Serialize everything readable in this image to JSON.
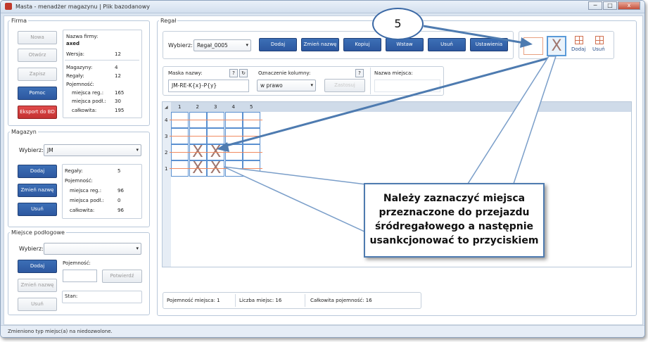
{
  "window": {
    "title": "Masta - menadżer magazynu | Plik bazodanowy",
    "min": "─",
    "max": "□",
    "close": "x"
  },
  "firma": {
    "legend": "Firma",
    "buttons": {
      "nowa": "Nowa",
      "otworz": "Otwórz",
      "zapisz": "Zapisz",
      "pomoc": "Pomoc",
      "eksport": "Eksport do BD"
    },
    "info": {
      "nazwa_label": "Nazwa firmy:",
      "nazwa_value": "axed",
      "wersja_label": "Wersja:",
      "wersja_value": "12",
      "magazyny_label": "Magazyny:",
      "magazyny_value": "4",
      "regaly_label": "Regały:",
      "regaly_value": "12",
      "pojemnosc_label": "Pojemność:",
      "mreg_label": "miejsca reg.:",
      "mreg_value": "165",
      "mpodl_label": "miejsca podł.:",
      "mpodl_value": "30",
      "calk_label": "całkowita:",
      "calk_value": "195"
    }
  },
  "magazyn": {
    "legend": "Magazyn",
    "wybierz_label": "Wybierz:",
    "selected": "JM",
    "buttons": {
      "dodaj": "Dodaj",
      "zmien": "Zmień nazwę",
      "usun": "Usuń"
    },
    "info": {
      "regaly_label": "Regały:",
      "regaly_value": "5",
      "pojemnosc_label": "Pojemność:",
      "mreg_label": "miejsca reg.:",
      "mreg_value": "96",
      "mpodl_label": "miejsca podł.:",
      "mpodl_value": "0",
      "calk_label": "całkowita:",
      "calk_value": "96"
    }
  },
  "miejsce": {
    "legend": "Miejsce podłogowe",
    "wybierz_label": "Wybierz:",
    "selected": "",
    "pojemnosc_label": "Pojemność:",
    "stan_label": "Stan:",
    "buttons": {
      "dodaj": "Dodaj",
      "zmien": "Zmień nazwę",
      "usun": "Usuń",
      "potwierdz": "Potwierdź"
    }
  },
  "regal": {
    "legend": "Regał",
    "wybierz_label": "Wybierz:",
    "selected": "Regał_0005",
    "buttons": {
      "dodaj": "Dodaj",
      "zmien": "Zmień nazwę",
      "kopiuj": "Kopiuj",
      "wstaw": "Wstaw",
      "usun": "Usuń",
      "ustawienia": "Ustawienia"
    },
    "tools": {
      "dodaj": "Dodaj",
      "usun": "Usuń"
    },
    "maska_label": "Maska nazwy:",
    "maska_help": "?",
    "maska_value": "JM-RE-K{x}-P{y}",
    "oznaczenie_label": "Oznaczenie kolumny:",
    "oznaczenie_help": "?",
    "oznaczenie_value": "w prawo",
    "zastosuj": "Zastosuj",
    "nazwa_miejsca_label": "Nazwa miejsca:",
    "nazwa_miejsca_value": ""
  },
  "grid": {
    "columns": [
      "1",
      "2",
      "3",
      "4",
      "5"
    ],
    "rows": [
      "4",
      "3",
      "2",
      "1"
    ],
    "marked": [
      {
        "row": "2",
        "col": "2"
      },
      {
        "row": "2",
        "col": "3"
      },
      {
        "row": "1",
        "col": "2"
      },
      {
        "row": "1",
        "col": "3"
      }
    ]
  },
  "footer": {
    "pojemnosc_miejsca": "Pojemność miejsca: 1",
    "liczba_miejsc": "Liczba miejsc: 16",
    "calkowita": "Całkowita pojemność: 16"
  },
  "status": "Zmieniono typ miejsc(a) na niedozwolone.",
  "annotation": {
    "number": "5",
    "callout_lines": [
      "Należy zaznaczyć miejsca",
      "przeznaczone do przejazdu",
      "śródregałowego a następnie",
      "usankcjonować to przyciskiem"
    ]
  }
}
